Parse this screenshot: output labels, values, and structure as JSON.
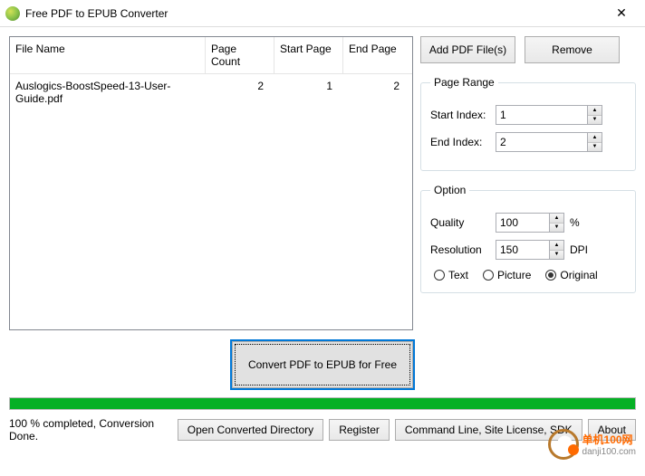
{
  "titlebar": {
    "title": "Free PDF to EPUB Converter"
  },
  "table": {
    "headers": {
      "filename": "File Name",
      "page_count": "Page Count",
      "start_page": "Start Page",
      "end_page": "End Page"
    },
    "rows": [
      {
        "filename": "Auslogics-BoostSpeed-13-User-Guide.pdf",
        "page_count": "2",
        "start_page": "1",
        "end_page": "2"
      }
    ]
  },
  "buttons": {
    "add": "Add PDF File(s)",
    "remove": "Remove",
    "convert": "Convert PDF to EPUB for Free",
    "open_dir": "Open Converted Directory",
    "register": "Register",
    "cmdline": "Command Line, Site License, SDK",
    "about": "About"
  },
  "page_range": {
    "legend": "Page Range",
    "start_label": "Start Index:",
    "start_value": "1",
    "end_label": "End Index:",
    "end_value": "2"
  },
  "option": {
    "legend": "Option",
    "quality_label": "Quality",
    "quality_value": "100",
    "quality_unit": "%",
    "resolution_label": "Resolution",
    "resolution_value": "150",
    "resolution_unit": "DPI",
    "radio_text": "Text",
    "radio_picture": "Picture",
    "radio_original": "Original"
  },
  "status": "100 % completed, Conversion Done.",
  "watermark": {
    "cn": "单机100网",
    "url": "danji100.com"
  }
}
